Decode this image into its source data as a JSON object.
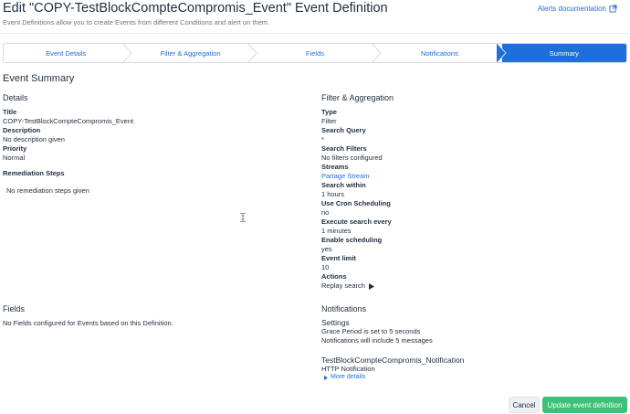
{
  "header": {
    "title": "Edit \"COPY-TestBlockCompteCompromis_Event\" Event Definition",
    "subtitle": "Event Definitions allow you to create Events from different Conditions and alert on them.",
    "docs_link": "Alerts documentation"
  },
  "wizard": {
    "steps": [
      "Event Details",
      "Filter & Aggregation",
      "Fields",
      "Notifications",
      "Summary"
    ],
    "active_step": "Summary"
  },
  "summary": {
    "title": "Event Summary",
    "details": {
      "heading": "Details",
      "title_label": "Title",
      "title_value": "COPY-TestBlockCompteCompromis_Event",
      "description_label": "Description",
      "description_value": "No description given",
      "priority_label": "Priority",
      "priority_value": "Normal",
      "remediation_label": "Remediation Steps",
      "remediation_value": "No remediation steps given"
    },
    "filter": {
      "heading": "Filter & Aggregation",
      "type_label": "Type",
      "type_value": "Filter",
      "query_label": "Search Query",
      "query_value": "*",
      "filters_label": "Search Filters",
      "filters_value": "No filters configured",
      "streams_label": "Streams",
      "streams_value": "Partage Stream",
      "within_label": "Search within",
      "within_value": "1 hours",
      "cron_label": "Use Cron Scheduling",
      "cron_value": "no",
      "execute_label": "Execute search every",
      "execute_value": "1 minutes",
      "scheduling_label": "Enable scheduling",
      "scheduling_value": "yes",
      "limit_label": "Event limit",
      "limit_value": "10",
      "actions_label": "Actions",
      "replay_label": "Replay search"
    },
    "fields": {
      "heading": "Fields",
      "value": "No Fields configured for Events based on this Definition."
    },
    "notifications": {
      "heading": "Notifications",
      "settings_heading": "Settings",
      "grace_period": "Grace Period is set to 5 seconds",
      "messages": "Notifications will include 5 messages",
      "notification_name": "TestBlockCompteCompromis_Notification",
      "notification_type": "HTTP Notification",
      "more_details": "More details"
    }
  },
  "footer": {
    "cancel_label": "Cancel",
    "update_label": "Update event definition"
  },
  "colors": {
    "accent": "#1e6fd9",
    "success": "#3fbf77",
    "text": "#1f2d3d",
    "muted": "#6b7785"
  }
}
